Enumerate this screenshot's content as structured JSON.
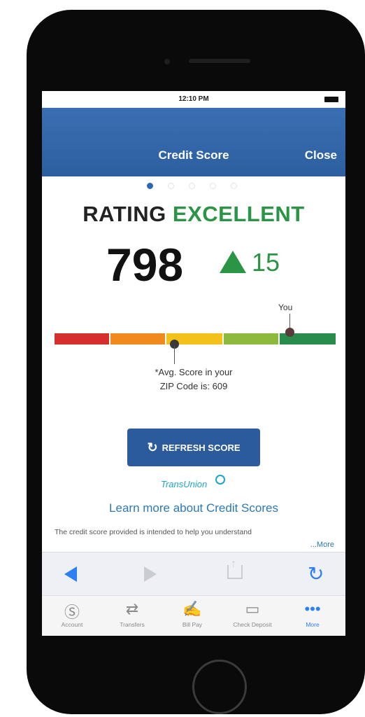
{
  "status_bar": {
    "time": "12:10 PM"
  },
  "nav": {
    "title": "Credit Score",
    "close": "Close"
  },
  "page_dots": {
    "count": 5,
    "active": 0
  },
  "rating": {
    "label": "RATING",
    "value": "EXCELLENT"
  },
  "score": {
    "value": "798",
    "change": "15",
    "direction": "up"
  },
  "score_bar": {
    "you_label": "You",
    "segment_colors": [
      "#d62d2d",
      "#f08a1c",
      "#f2c21a",
      "#8db93d",
      "#2a8c4c"
    ],
    "you_position": 0.87,
    "avg_position": 0.43
  },
  "avg_note": {
    "line1": "*Avg. Score in your",
    "line2": "ZIP Code is: 609"
  },
  "refresh_button": {
    "label": "REFRESH SCORE"
  },
  "transunion": {
    "logo_text": "TransUnion"
  },
  "learn_more": {
    "label": "Learn more about Credit Scores"
  },
  "disclaimer": {
    "text": "The credit score provided is intended to help you understand",
    "more": "...More"
  },
  "toolbar": {
    "back": "back-arrow-icon",
    "forward": "forward-arrow-icon",
    "share": "share-icon",
    "reload": "reload-icon"
  },
  "tabs": [
    {
      "label": "Account",
      "icon": "dollar-circle-icon"
    },
    {
      "label": "Transfers",
      "icon": "transfer-arrows-icon"
    },
    {
      "label": "Bill Pay",
      "icon": "bill-pay-icon"
    },
    {
      "label": "Check Deposit",
      "icon": "check-icon"
    },
    {
      "label": "More",
      "icon": "ellipsis-icon"
    }
  ],
  "colors": {
    "nav_blue": "#2c5f9f",
    "excellent_green": "#2a9545",
    "link_blue": "#2b79b6",
    "ios_blue": "#2e7ff2"
  }
}
